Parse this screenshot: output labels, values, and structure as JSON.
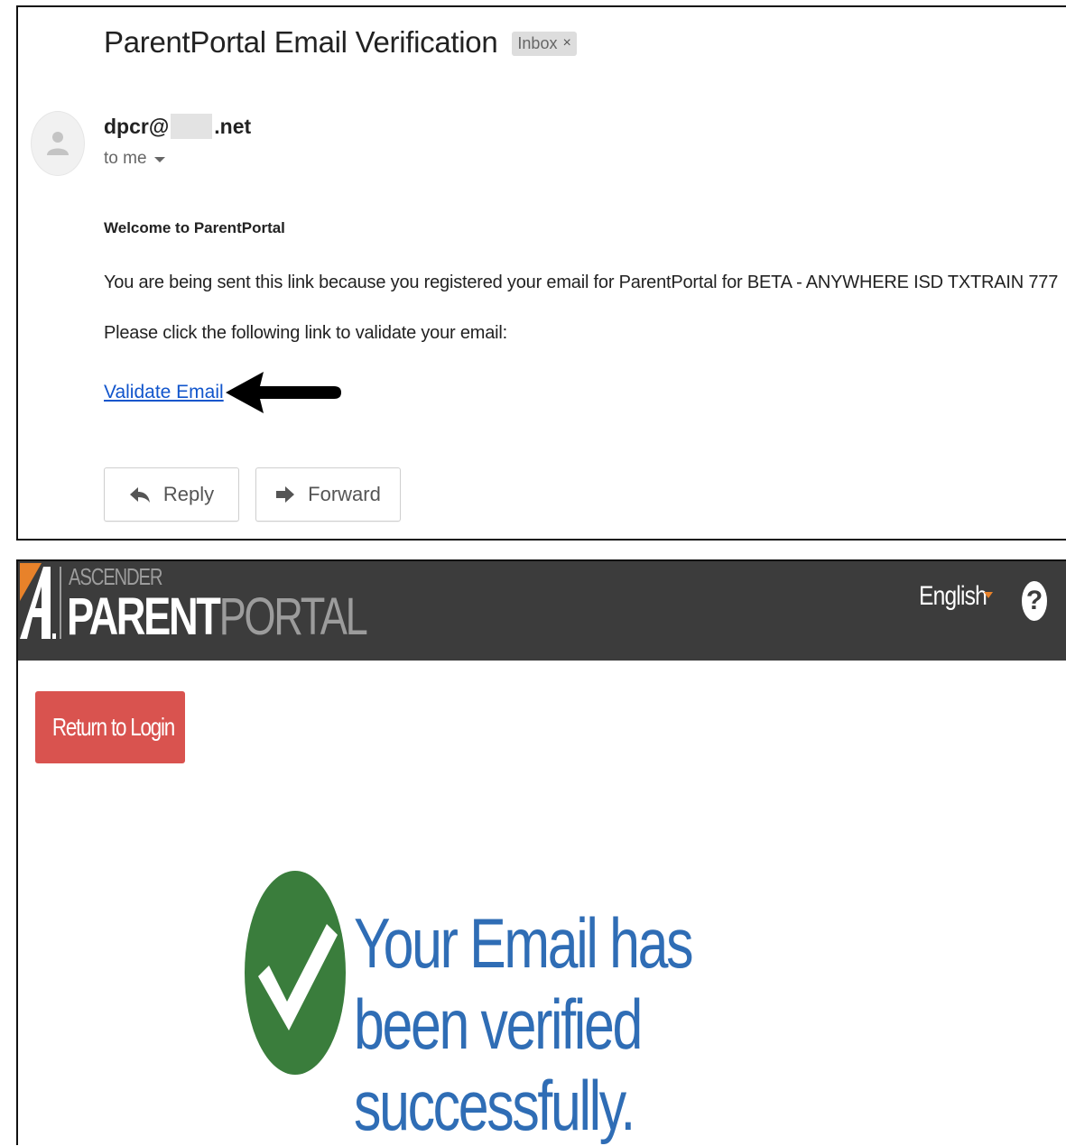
{
  "email": {
    "subject": "ParentPortal Email Verification",
    "label_chip": "Inbox",
    "label_chip_close": "×",
    "sender_prefix": "dpcr@",
    "sender_suffix": ".net",
    "recipient": "to me",
    "greeting": "Welcome to ParentPortal",
    "body_line1": "You are being sent this link because you registered your email for ParentPortal for BETA - ANYWHERE ISD TXTRAIN 777",
    "body_line2": "Please click the following link to validate your email:",
    "validate_link": "Validate Email",
    "reply_label": "Reply",
    "forward_label": "Forward",
    "icons": {
      "avatar": "person-icon",
      "reply": "reply-icon",
      "forward": "forward-icon",
      "arrow": "left-arrow-icon"
    }
  },
  "portal": {
    "brand_small": "ASCENDER",
    "brand_strong": "PARENT",
    "brand_light": "PORTAL",
    "language": "English",
    "help_glyph": "?",
    "return_label": "Return to Login",
    "success_message": "Your Email has been verified successfully.",
    "colors": {
      "header_bg": "#3c3c3c",
      "accent_orange": "#e8822a",
      "return_button": "#d9534f",
      "success_green": "#3a7d3c",
      "success_text": "#2f6db5",
      "link_blue": "#1155cc"
    }
  }
}
